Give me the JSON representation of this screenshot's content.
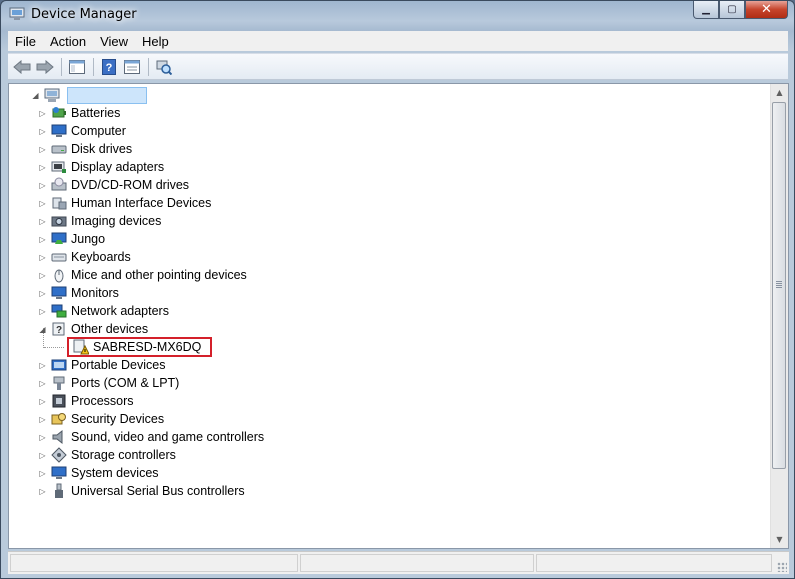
{
  "window": {
    "title": "Device Manager",
    "title_icon": "device-manager-icon",
    "buttons": {
      "minimize": "minimize-icon",
      "maximize": "maximize-icon",
      "close": "close-icon"
    }
  },
  "menu": [
    "File",
    "Action",
    "View",
    "Help"
  ],
  "toolbar": [
    "back-arrow-icon",
    "forward-arrow-icon",
    "show-hide-console-tree-icon",
    "help-icon",
    "properties-icon",
    "scan-hardware-changes-icon"
  ],
  "tree": {
    "root": {
      "label": "",
      "icon": "computer-root-icon",
      "selected": true
    },
    "categories": [
      {
        "label": "Batteries",
        "icon": "battery-icon",
        "expanded": false
      },
      {
        "label": "Computer",
        "icon": "computer-icon",
        "expanded": false
      },
      {
        "label": "Disk drives",
        "icon": "disk-drive-icon",
        "expanded": false
      },
      {
        "label": "Display adapters",
        "icon": "display-adapter-icon",
        "expanded": false
      },
      {
        "label": "DVD/CD-ROM drives",
        "icon": "dvd-drive-icon",
        "expanded": false
      },
      {
        "label": "Human Interface Devices",
        "icon": "hid-icon",
        "expanded": false
      },
      {
        "label": "Imaging devices",
        "icon": "camera-icon",
        "expanded": false
      },
      {
        "label": "Jungo",
        "icon": "jungo-icon",
        "expanded": false
      },
      {
        "label": "Keyboards",
        "icon": "keyboard-icon",
        "expanded": false
      },
      {
        "label": "Mice and other pointing devices",
        "icon": "mouse-icon",
        "expanded": false
      },
      {
        "label": "Monitors",
        "icon": "monitor-icon",
        "expanded": false
      },
      {
        "label": "Network adapters",
        "icon": "network-adapter-icon",
        "expanded": false
      },
      {
        "label": "Other devices",
        "icon": "unknown-device-icon",
        "expanded": true,
        "children": [
          {
            "label": "SABRESD-MX6DQ",
            "icon": "warning-device-icon",
            "highlight_color": "#d4202a"
          }
        ]
      },
      {
        "label": "Portable Devices",
        "icon": "portable-device-icon",
        "expanded": false
      },
      {
        "label": "Ports (COM & LPT)",
        "icon": "port-icon",
        "expanded": false
      },
      {
        "label": "Processors",
        "icon": "processor-icon",
        "expanded": false
      },
      {
        "label": "Security Devices",
        "icon": "security-device-icon",
        "expanded": false
      },
      {
        "label": "Sound, video and game controllers",
        "icon": "sound-icon",
        "expanded": false
      },
      {
        "label": "Storage controllers",
        "icon": "storage-controller-icon",
        "expanded": false
      },
      {
        "label": "System devices",
        "icon": "system-devices-icon",
        "expanded": false
      },
      {
        "label": "Universal Serial Bus controllers",
        "icon": "usb-icon",
        "expanded": false
      }
    ]
  },
  "statusbar": {
    "text": ""
  },
  "colors": {
    "selection": "#cde5fb",
    "highlight_border": "#d4202a"
  }
}
